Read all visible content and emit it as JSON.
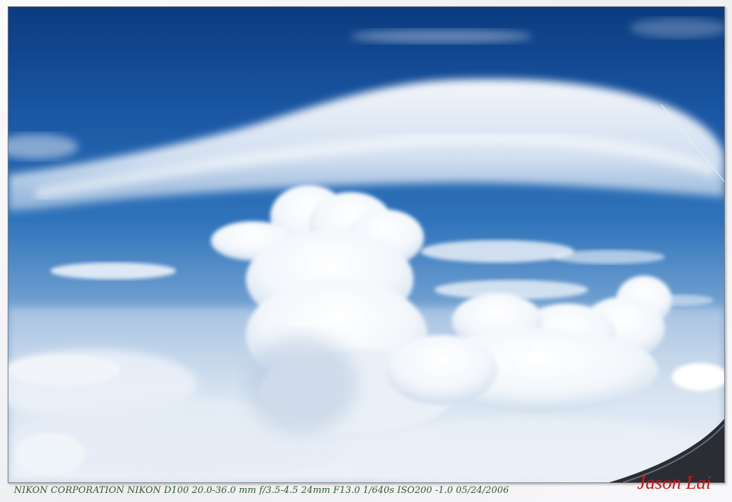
{
  "photo": {
    "subject": "cloud-sky-photo",
    "colors": {
      "sky_top": "#0c3f86",
      "sky_mid": "#2b6fb8",
      "sky_horizon": "#8fb6de",
      "cloud": "#ffffff",
      "cloud_shadow": "#c3d5e8"
    }
  },
  "caption": {
    "exif": "NIKON CORPORATION NIKON D100 20.0-36.0 mm f/3.5-4.5 24mm F13.0 1/640s ISO200 -1.0  05/24/2006"
  },
  "signature": {
    "name": "Jason Lai",
    "color": "#d1141b"
  }
}
